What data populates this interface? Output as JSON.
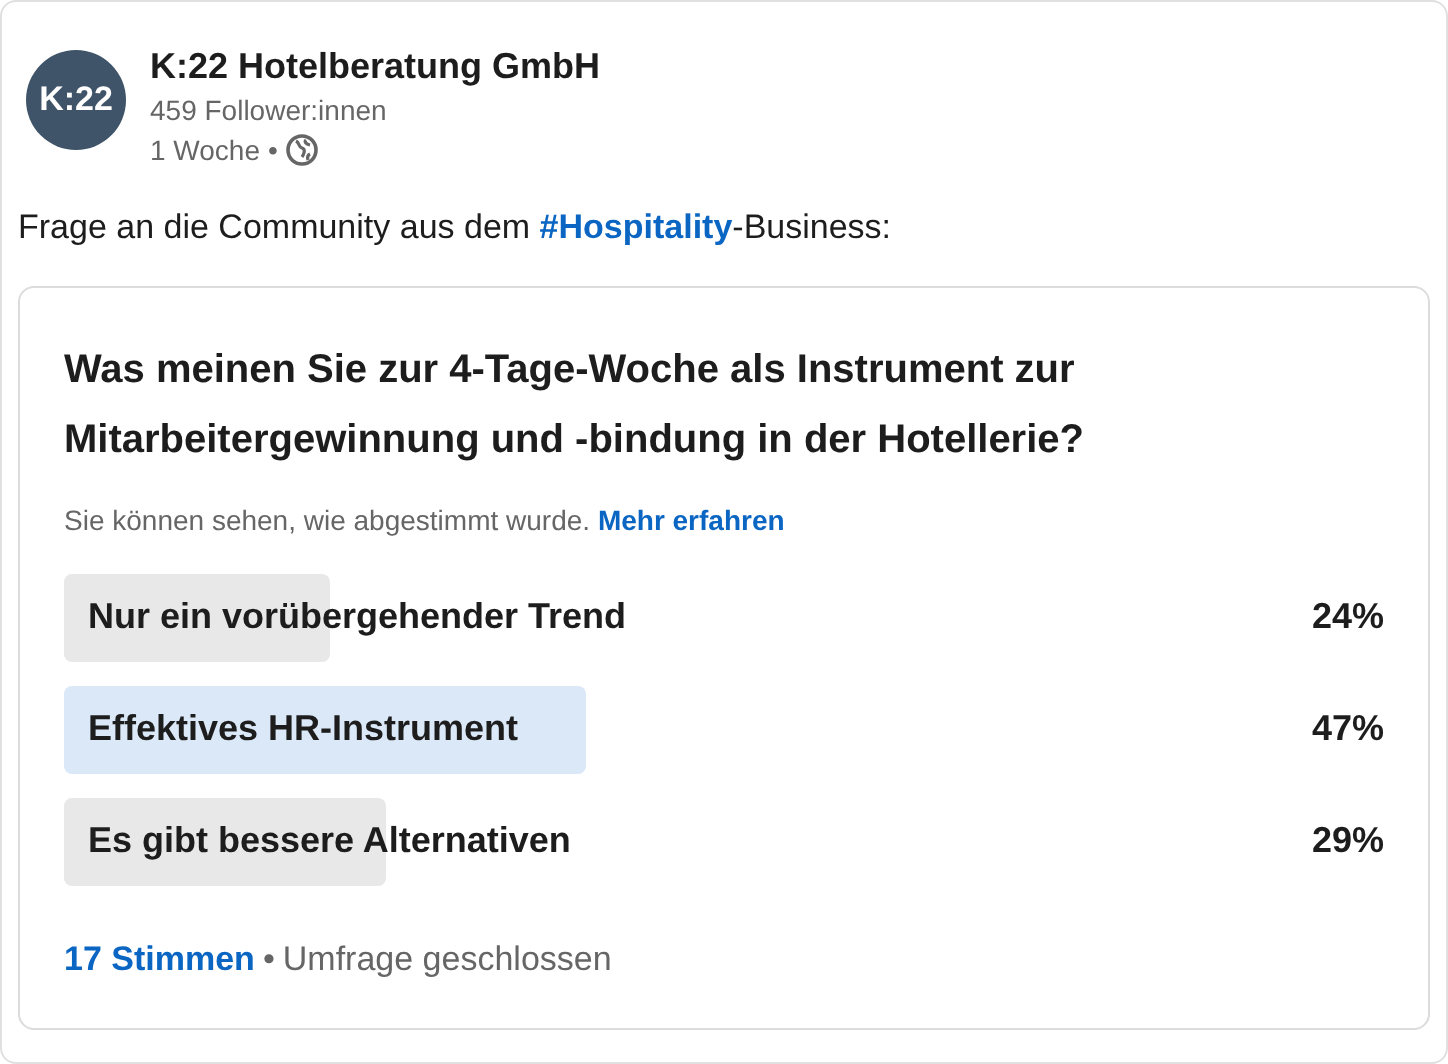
{
  "author": {
    "avatar_text": "K:22",
    "name": "K:22 Hotelberatung GmbH",
    "followers": "459 Follower:innen",
    "time": "1 Woche",
    "separator": "•"
  },
  "post_text": {
    "before": "Frage an die Community aus dem ",
    "hashtag": "#Hospitality",
    "after": "-Business:"
  },
  "poll": {
    "question": "Was meinen Sie zur 4-Tage-Woche als Instrument zur Mitarbeitergewinnung und -bindung in der Hotellerie?",
    "visibility_note": "Sie können sehen, wie abgestimmt wurde.",
    "learn_more": "Mehr erfahren",
    "options": [
      {
        "label": "Nur ein vorübergehender Trend",
        "percent": "24%",
        "selected": false
      },
      {
        "label": "Effektives HR-Instrument",
        "percent": "47%",
        "selected": true
      },
      {
        "label": "Es gibt bessere Alternativen",
        "percent": "29%",
        "selected": false
      }
    ],
    "votes": "17 Stimmen",
    "separator": "•",
    "status": "Umfrage geschlossen"
  }
}
